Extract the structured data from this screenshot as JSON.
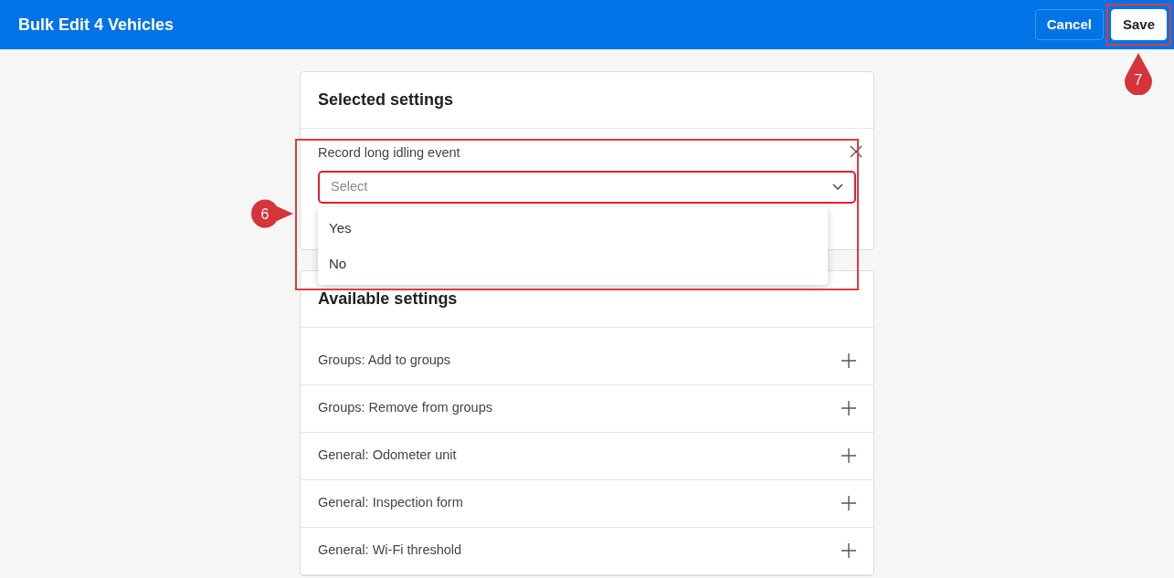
{
  "header": {
    "title": "Bulk Edit 4 Vehicles",
    "buttons": [
      {
        "label": "Cancel",
        "kind": "outline"
      },
      {
        "label": "Save",
        "kind": "solid"
      }
    ]
  },
  "selected_settings": {
    "title": "Selected settings",
    "fields": [
      {
        "label": "Record long idling event",
        "placeholder": "Select",
        "expanded": true,
        "options": [
          {
            "label": "Yes",
            "selected": false
          },
          {
            "label": "No",
            "selected": false
          }
        ]
      }
    ]
  },
  "available_settings": {
    "title": "Available settings",
    "items": [
      {
        "label": "Groups: Add to groups"
      },
      {
        "label": "Groups: Remove from groups"
      },
      {
        "label": "General: Odometer unit"
      },
      {
        "label": "General: Inspection form"
      },
      {
        "label": "General: Wi-Fi threshold"
      }
    ]
  },
  "callouts": [
    {
      "label": "6",
      "kind": "side"
    },
    {
      "label": "7",
      "kind": "below"
    }
  ]
}
